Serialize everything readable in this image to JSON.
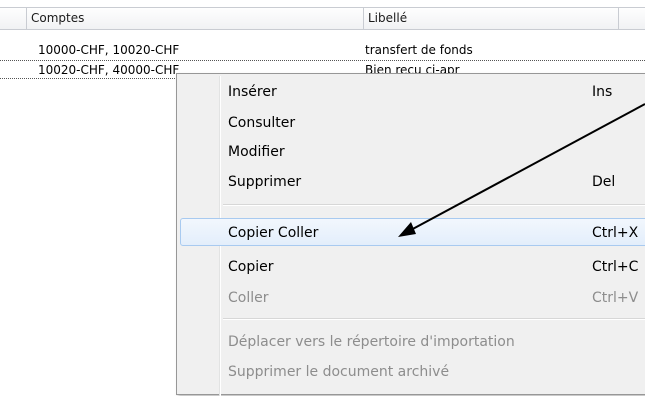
{
  "grid": {
    "columns": [
      "Comptes",
      "Libellé"
    ],
    "rows": [
      {
        "comptes": "10000-CHF, 10020-CHF",
        "libelle": "transfert de fonds"
      },
      {
        "comptes": "10020-CHF, 40000-CHF",
        "libelle": "Bien reçu ci-apr"
      }
    ]
  },
  "context_menu": {
    "items": [
      {
        "label": "Insérer",
        "shortcut": "Ins",
        "enabled": true
      },
      {
        "label": "Consulter",
        "shortcut": "",
        "enabled": true
      },
      {
        "label": "Modifier",
        "shortcut": "",
        "enabled": true
      },
      {
        "label": "Supprimer",
        "shortcut": "Del",
        "enabled": true
      },
      {
        "label": "Copier Coller",
        "shortcut": "Ctrl+X",
        "enabled": true,
        "highlighted": true
      },
      {
        "label": "Copier",
        "shortcut": "Ctrl+C",
        "enabled": true
      },
      {
        "label": "Coller",
        "shortcut": "Ctrl+V",
        "enabled": false
      },
      {
        "label": "Déplacer vers le répertoire d'importation",
        "shortcut": "",
        "enabled": false
      },
      {
        "label": "Supprimer le document archivé",
        "shortcut": "",
        "enabled": false
      }
    ]
  },
  "colors": {
    "highlight_border": "#a8caf0",
    "menu_bg": "#f0f0f0",
    "disabled_text": "#8d8d8d"
  }
}
